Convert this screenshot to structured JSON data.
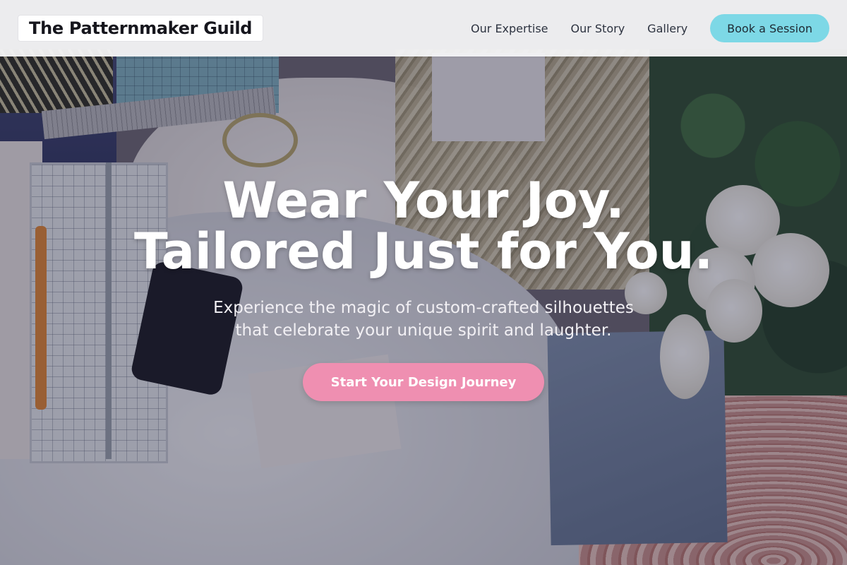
{
  "header": {
    "brand": "The Patternmaker Guild",
    "nav": [
      {
        "label": "Our Expertise"
      },
      {
        "label": "Our Story"
      },
      {
        "label": "Gallery"
      }
    ],
    "cta_label": "Book a Session"
  },
  "hero": {
    "headline_line1": "Wear Your Joy.",
    "headline_line2": "Tailored Just for You.",
    "subline_line1": "Experience the magic of custom-crafted silhouettes",
    "subline_line2": "that celebrate your unique spirit and laughter.",
    "cta_label": "Start Your Design Journey"
  },
  "colors": {
    "header_bg": "#f4f4f6",
    "book_button_bg": "#7dd8e6",
    "cta_bg": "#ef8fb1",
    "headline_text": "#ffffff"
  }
}
